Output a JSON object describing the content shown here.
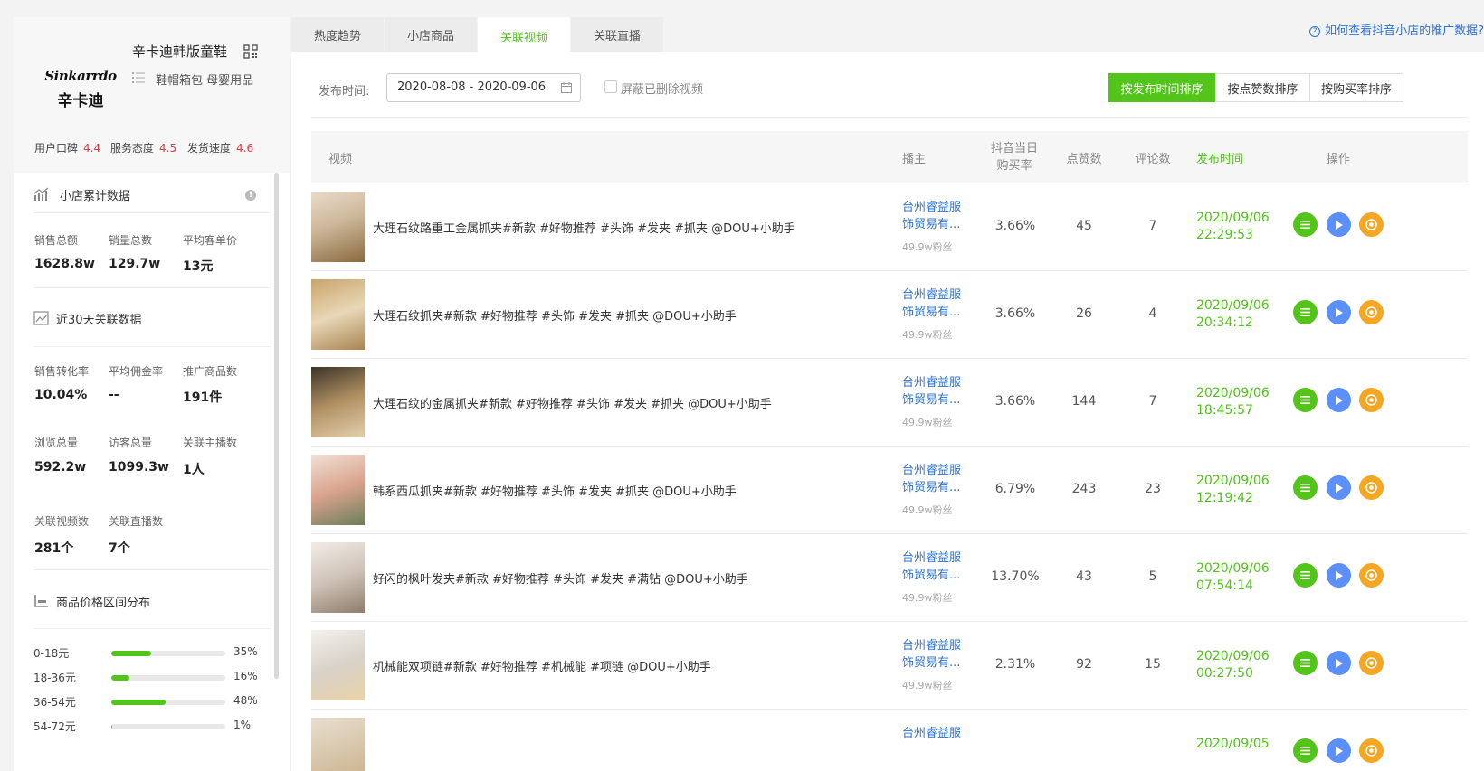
{
  "shop": {
    "logo_line1": "Sinkarrdo",
    "logo_line2": "辛卡迪",
    "name": "辛卡迪韩版童鞋",
    "categories": "鞋帽箱包 母婴用品",
    "scores": [
      {
        "label": "用户口碑",
        "value": "4.4"
      },
      {
        "label": "服务态度",
        "value": "4.5"
      },
      {
        "label": "发货速度",
        "value": "4.6"
      }
    ]
  },
  "cumulative": {
    "title": "小店累计数据",
    "stats": [
      {
        "label": "销售总额",
        "value": "1628.8w"
      },
      {
        "label": "销量总数",
        "value": "129.7w"
      },
      {
        "label": "平均客单价",
        "value": "13元"
      }
    ]
  },
  "recent": {
    "title": "近30天关联数据",
    "stats": [
      {
        "label": "销售转化率",
        "value": "10.04%"
      },
      {
        "label": "平均佣金率",
        "value": "--"
      },
      {
        "label": "推广商品数",
        "value": "191件"
      },
      {
        "label": "浏览总量",
        "value": "592.2w"
      },
      {
        "label": "访客总量",
        "value": "1099.3w"
      },
      {
        "label": "关联主播数",
        "value": "1人"
      },
      {
        "label": "关联视频数",
        "value": "281个"
      },
      {
        "label": "关联直播数",
        "value": "7个"
      }
    ]
  },
  "price_dist": {
    "title": "商品价格区间分布",
    "items": [
      {
        "label": "0-18元",
        "pct": 35,
        "pct_text": "35%"
      },
      {
        "label": "18-36元",
        "pct": 16,
        "pct_text": "16%"
      },
      {
        "label": "36-54元",
        "pct": 48,
        "pct_text": "48%"
      },
      {
        "label": "54-72元",
        "pct": 1,
        "pct_text": "1%"
      }
    ]
  },
  "tabs": [
    {
      "label": "热度趋势",
      "active": false
    },
    {
      "label": "小店商品",
      "active": false
    },
    {
      "label": "关联视频",
      "active": true
    },
    {
      "label": "关联直播",
      "active": false
    }
  ],
  "help_link": "如何查看抖音小店的推广数据?",
  "filter": {
    "date_label": "发布时间:",
    "date_value": "2020-08-08 - 2020-09-06",
    "hide_deleted": "屏蔽已删除视频"
  },
  "sort_buttons": [
    {
      "label": "按发布时间排序",
      "active": true
    },
    {
      "label": "按点赞数排序",
      "active": false
    },
    {
      "label": "按购买率排序",
      "active": false
    }
  ],
  "table": {
    "headers": {
      "video": "视频",
      "anchor": "播主",
      "buy_rate_1": "抖音当日",
      "buy_rate_2": "购买率",
      "likes": "点赞数",
      "comments": "评论数",
      "publish_time": "发布时间",
      "actions": "操作"
    },
    "rows": [
      {
        "title": "大理石纹路重工金属抓夹#新款 #好物推荐 #头饰 #发夹 #抓夹 @DOU+小助手",
        "anchor_1": "台州睿益服",
        "anchor_2": "饰贸易有...",
        "fans": "49.9w粉丝",
        "rate": "3.66%",
        "likes": "45",
        "comments": "7",
        "date": "2020/09/06",
        "time": "22:29:53"
      },
      {
        "title": "大理石纹抓夹#新款 #好物推荐 #头饰 #发夹 #抓夹 @DOU+小助手",
        "anchor_1": "台州睿益服",
        "anchor_2": "饰贸易有...",
        "fans": "49.9w粉丝",
        "rate": "3.66%",
        "likes": "26",
        "comments": "4",
        "date": "2020/09/06",
        "time": "20:34:12"
      },
      {
        "title": "大理石纹的金属抓夹#新款 #好物推荐 #头饰 #发夹 #抓夹 @DOU+小助手",
        "anchor_1": "台州睿益服",
        "anchor_2": "饰贸易有...",
        "fans": "49.9w粉丝",
        "rate": "3.66%",
        "likes": "144",
        "comments": "7",
        "date": "2020/09/06",
        "time": "18:45:57"
      },
      {
        "title": "韩系西瓜抓夹#新款 #好物推荐 #头饰 #发夹 #抓夹 @DOU+小助手",
        "anchor_1": "台州睿益服",
        "anchor_2": "饰贸易有...",
        "fans": "49.9w粉丝",
        "rate": "6.79%",
        "likes": "243",
        "comments": "23",
        "date": "2020/09/06",
        "time": "12:19:42"
      },
      {
        "title": "好闪的枫叶发夹#新款 #好物推荐 #头饰 #发夹 #满钻 @DOU+小助手",
        "anchor_1": "台州睿益服",
        "anchor_2": "饰贸易有...",
        "fans": "49.9w粉丝",
        "rate": "13.70%",
        "likes": "43",
        "comments": "5",
        "date": "2020/09/06",
        "time": "07:54:14"
      },
      {
        "title": "机械能双项链#新款 #好物推荐 #机械能 #项链 @DOU+小助手",
        "anchor_1": "台州睿益服",
        "anchor_2": "饰贸易有...",
        "fans": "49.9w粉丝",
        "rate": "2.31%",
        "likes": "92",
        "comments": "15",
        "date": "2020/09/06",
        "time": "00:27:50"
      },
      {
        "title": "",
        "anchor_1": "台州睿益服",
        "anchor_2": "",
        "fans": "",
        "rate": "",
        "likes": "",
        "comments": "",
        "date": "2020/09/05",
        "time": ""
      }
    ]
  },
  "colors": {
    "accent": "#52c41a",
    "link": "#2b73d8",
    "score": "#e4393c"
  },
  "icons": {
    "qr": "qrcode-icon",
    "list": "list-icon",
    "play": "play-icon",
    "target": "target-icon"
  }
}
